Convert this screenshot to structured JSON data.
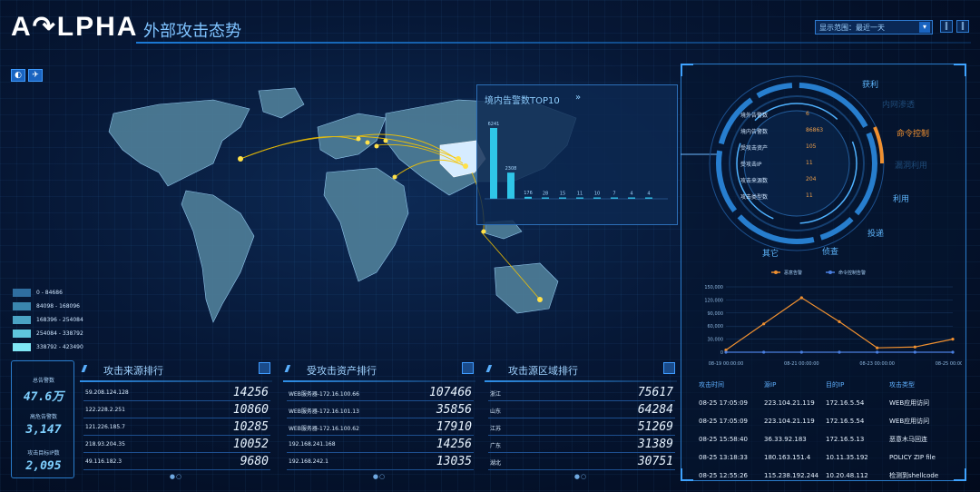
{
  "header": {
    "logo": "A↷LPHA",
    "title": "外部攻击态势",
    "select_value": "显示范围：最近一天",
    "select_arrow": "▾",
    "btn1": "‖",
    "btn2": "‖"
  },
  "map_controls": {
    "icon1": "◐",
    "icon2": "✈"
  },
  "legend": [
    {
      "label": "0 - 84686",
      "color": "#2f6ea0"
    },
    {
      "label": "84098 - 168096",
      "color": "#3a86ae"
    },
    {
      "label": "168396 - 254084",
      "color": "#4aa3c4"
    },
    {
      "label": "254084 - 338792",
      "color": "#5fc5dc"
    },
    {
      "label": "338792 - 423490",
      "color": "#7fe6f4"
    }
  ],
  "top10": {
    "title": "境内告警数TOP10",
    "more": "»",
    "chart_data": {
      "type": "bar",
      "values": [
        6241,
        2308,
        176,
        28,
        15,
        11,
        10,
        7,
        4,
        4
      ],
      "value_labels": [
        "6241",
        "2308",
        "176",
        "28",
        "15",
        "11",
        "10",
        "7",
        "4",
        "4"
      ],
      "colors": [
        "#2fc6e8",
        "#2fc6e8",
        "#2fc6e8",
        "#2fc6e8",
        "#2fc6e8",
        "#2fc6e8",
        "#2fc6e8",
        "#2fc6e8",
        "#2fc6e8",
        "#2fc6e8"
      ]
    }
  },
  "radial": {
    "stats": [
      {
        "label": "境外告警数",
        "value": "6"
      },
      {
        "label": "境内告警数",
        "value": "86863"
      },
      {
        "label": "受攻击资产",
        "value": "105"
      },
      {
        "label": "受攻击IP",
        "value": "11"
      },
      {
        "label": "攻击来源数",
        "value": "204"
      },
      {
        "label": "攻击类型数",
        "value": "11"
      }
    ],
    "stages": [
      {
        "label": "获利",
        "color": "#5fb8ff"
      },
      {
        "label": "内网渗透",
        "color": "#1e4a78"
      },
      {
        "label": "命令控制",
        "color": "#f09030"
      },
      {
        "label": "漏洞利用",
        "color": "#1e4a78"
      },
      {
        "label": "利用",
        "color": "#5fb8ff"
      },
      {
        "label": "投递",
        "color": "#5fb8ff"
      },
      {
        "label": "侦查",
        "color": "#5fb8ff"
      },
      {
        "label": "其它",
        "color": "#5fb8ff"
      }
    ]
  },
  "trend": {
    "legend": [
      {
        "label": "恶意告警",
        "color": "#f09030"
      },
      {
        "label": "命令控制告警",
        "color": "#4a7fe0"
      }
    ],
    "chart_data": {
      "type": "line",
      "x": [
        "08-19 00:00:00",
        "08-20",
        "08-21 00:00:00",
        "08-22",
        "08-23 00:00:00",
        "08-24",
        "08-25 00:00:00"
      ],
      "xticklabels": [
        "08-19 00:00:00",
        "08-21 00:00:00",
        "08-23 00:00:00",
        "08-25 00:00:00"
      ],
      "series": [
        {
          "name": "恶意告警",
          "values": [
            5000,
            65000,
            125000,
            70000,
            10000,
            12000,
            30000
          ],
          "color": "#f09030"
        },
        {
          "name": "命令控制告警",
          "values": [
            0,
            0,
            0,
            0,
            0,
            0,
            0
          ],
          "color": "#4a7fe0"
        }
      ],
      "ylim": [
        0,
        150000
      ],
      "yticks": [
        "0",
        "30,000",
        "60,000",
        "90,000",
        "120,000",
        "150,000"
      ]
    }
  },
  "attacks": {
    "headers": [
      "攻击时间",
      "源IP",
      "目的IP",
      "攻击类型"
    ],
    "rows": [
      [
        "08-25 17:05:09",
        "223.104.21.119",
        "172.16.5.54",
        "WEB应用访问"
      ],
      [
        "08-25 17:05:09",
        "223.104.21.119",
        "172.16.5.54",
        "WEB应用访问"
      ],
      [
        "08-25 15:58:40",
        "36.33.92.183",
        "172.16.5.13",
        "恶意木马回连"
      ],
      [
        "08-25 13:18:33",
        "180.163.151.4",
        "10.11.35.192",
        "POLICY ZIP file"
      ],
      [
        "08-25 12:55:26",
        "115.238.192.244",
        "10.20.48.112",
        "检测到shellcode"
      ]
    ]
  },
  "stats": [
    {
      "label": "总告警数",
      "value": "47.6万"
    },
    {
      "label": "高危告警数",
      "value": "3,147"
    },
    {
      "label": "攻击目标IP数",
      "value": "2,095"
    }
  ],
  "source_rank": {
    "title": "攻击来源排行",
    "rows": [
      {
        "name": "59.208.124.128",
        "value": "14256"
      },
      {
        "name": "122.228.2.251",
        "value": "10860"
      },
      {
        "name": "121.226.185.7",
        "value": "10285"
      },
      {
        "name": "218.93.204.35",
        "value": "10052"
      },
      {
        "name": "49.116.182.3",
        "value": "9680"
      }
    ]
  },
  "asset_rank": {
    "title": "受攻击资产排行",
    "rows": [
      {
        "name": "WEB服务器-172.16.100.66",
        "value": "107466"
      },
      {
        "name": "WEB服务器-172.16.101.13",
        "value": "35856"
      },
      {
        "name": "WEB服务器-172.16.100.62",
        "value": "17910"
      },
      {
        "name": "192.168.241.168",
        "value": "14256"
      },
      {
        "name": "192.168.242.1",
        "value": "13035"
      }
    ]
  },
  "region_rank": {
    "title": "攻击源区域排行",
    "rows": [
      {
        "name": "浙江",
        "value": "75617"
      },
      {
        "name": "山东",
        "value": "64284"
      },
      {
        "name": "江苏",
        "value": "51269"
      },
      {
        "name": "广东",
        "value": "31389"
      },
      {
        "name": "湖北",
        "value": "30751"
      }
    ]
  },
  "pager": "●○",
  "rank_slashes": "///",
  "colors": {
    "accent": "#2f8fe8",
    "map_land": "#5b8fa8",
    "map_china": "#cfe9ff",
    "arc": "#f5c400"
  }
}
